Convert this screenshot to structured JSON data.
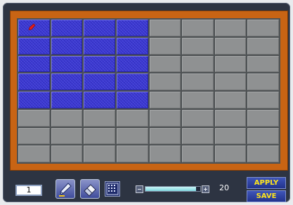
{
  "grid": {
    "rows": 8,
    "cols": 8,
    "selected": [
      [
        1,
        1,
        1,
        1,
        0,
        0,
        0,
        0
      ],
      [
        1,
        1,
        1,
        1,
        0,
        0,
        0,
        0
      ],
      [
        1,
        1,
        1,
        1,
        0,
        0,
        0,
        0
      ],
      [
        1,
        1,
        1,
        1,
        0,
        0,
        0,
        0
      ],
      [
        1,
        1,
        1,
        1,
        0,
        0,
        0,
        0
      ],
      [
        0,
        0,
        0,
        0,
        0,
        0,
        0,
        0
      ],
      [
        0,
        0,
        0,
        0,
        0,
        0,
        0,
        0
      ],
      [
        0,
        0,
        0,
        0,
        0,
        0,
        0,
        0
      ]
    ],
    "cursor_cell": {
      "row": 0,
      "col": 0
    }
  },
  "toolbar": {
    "channel_number": "1",
    "pen_tool_icon": "pen-icon",
    "eraser_tool_icon": "eraser-icon",
    "grid_tool_icon": "grid-icon",
    "sensitivity_value": "20",
    "sensitivity_fraction": 0.92,
    "apply_label": "APPLY",
    "save_label": "SAVE"
  },
  "colors": {
    "border_orange": "#c86414",
    "selected_cell": "#3a37cf",
    "empty_cell": "#8f9192",
    "button_text": "#ffe51b"
  }
}
